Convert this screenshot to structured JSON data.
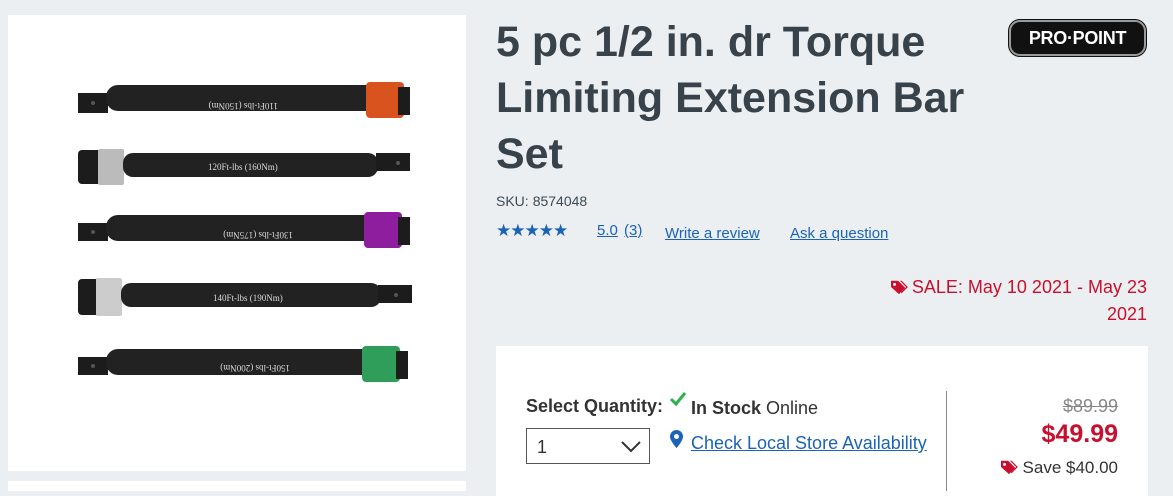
{
  "product": {
    "title": "5 pc 1/2 in. dr Torque Limiting Extension Bar Set",
    "brand": "PRO·POINT",
    "sku_label": "SKU:",
    "sku": "8574048",
    "rating_stars": "★★★★★",
    "rating": "5.0",
    "review_count": "(3)",
    "write_review": "Write a review",
    "ask_question": "Ask a question",
    "sale_text": "SALE: May 10 2021 - May 23 2021",
    "image_labels": [
      "110Ft-lbs (150Nm)",
      "120Ft-lbs (160Nm)",
      "130Ft-lbs (175Nm)",
      "140Ft-lbs (190Nm)",
      "150Ft-lbs (200Nm)"
    ]
  },
  "purchase": {
    "qty_label": "Select Quantity:",
    "qty_value": "1",
    "stock_status": "In Stock",
    "stock_location": "Online",
    "store_link": "Check Local Store Availability",
    "old_price": "$89.99",
    "new_price": "$49.99",
    "savings": "Save $40.00"
  },
  "colors": {
    "sale_red": "#c8102e",
    "link_blue": "#1b63b6",
    "check_green": "#2bb24c"
  }
}
